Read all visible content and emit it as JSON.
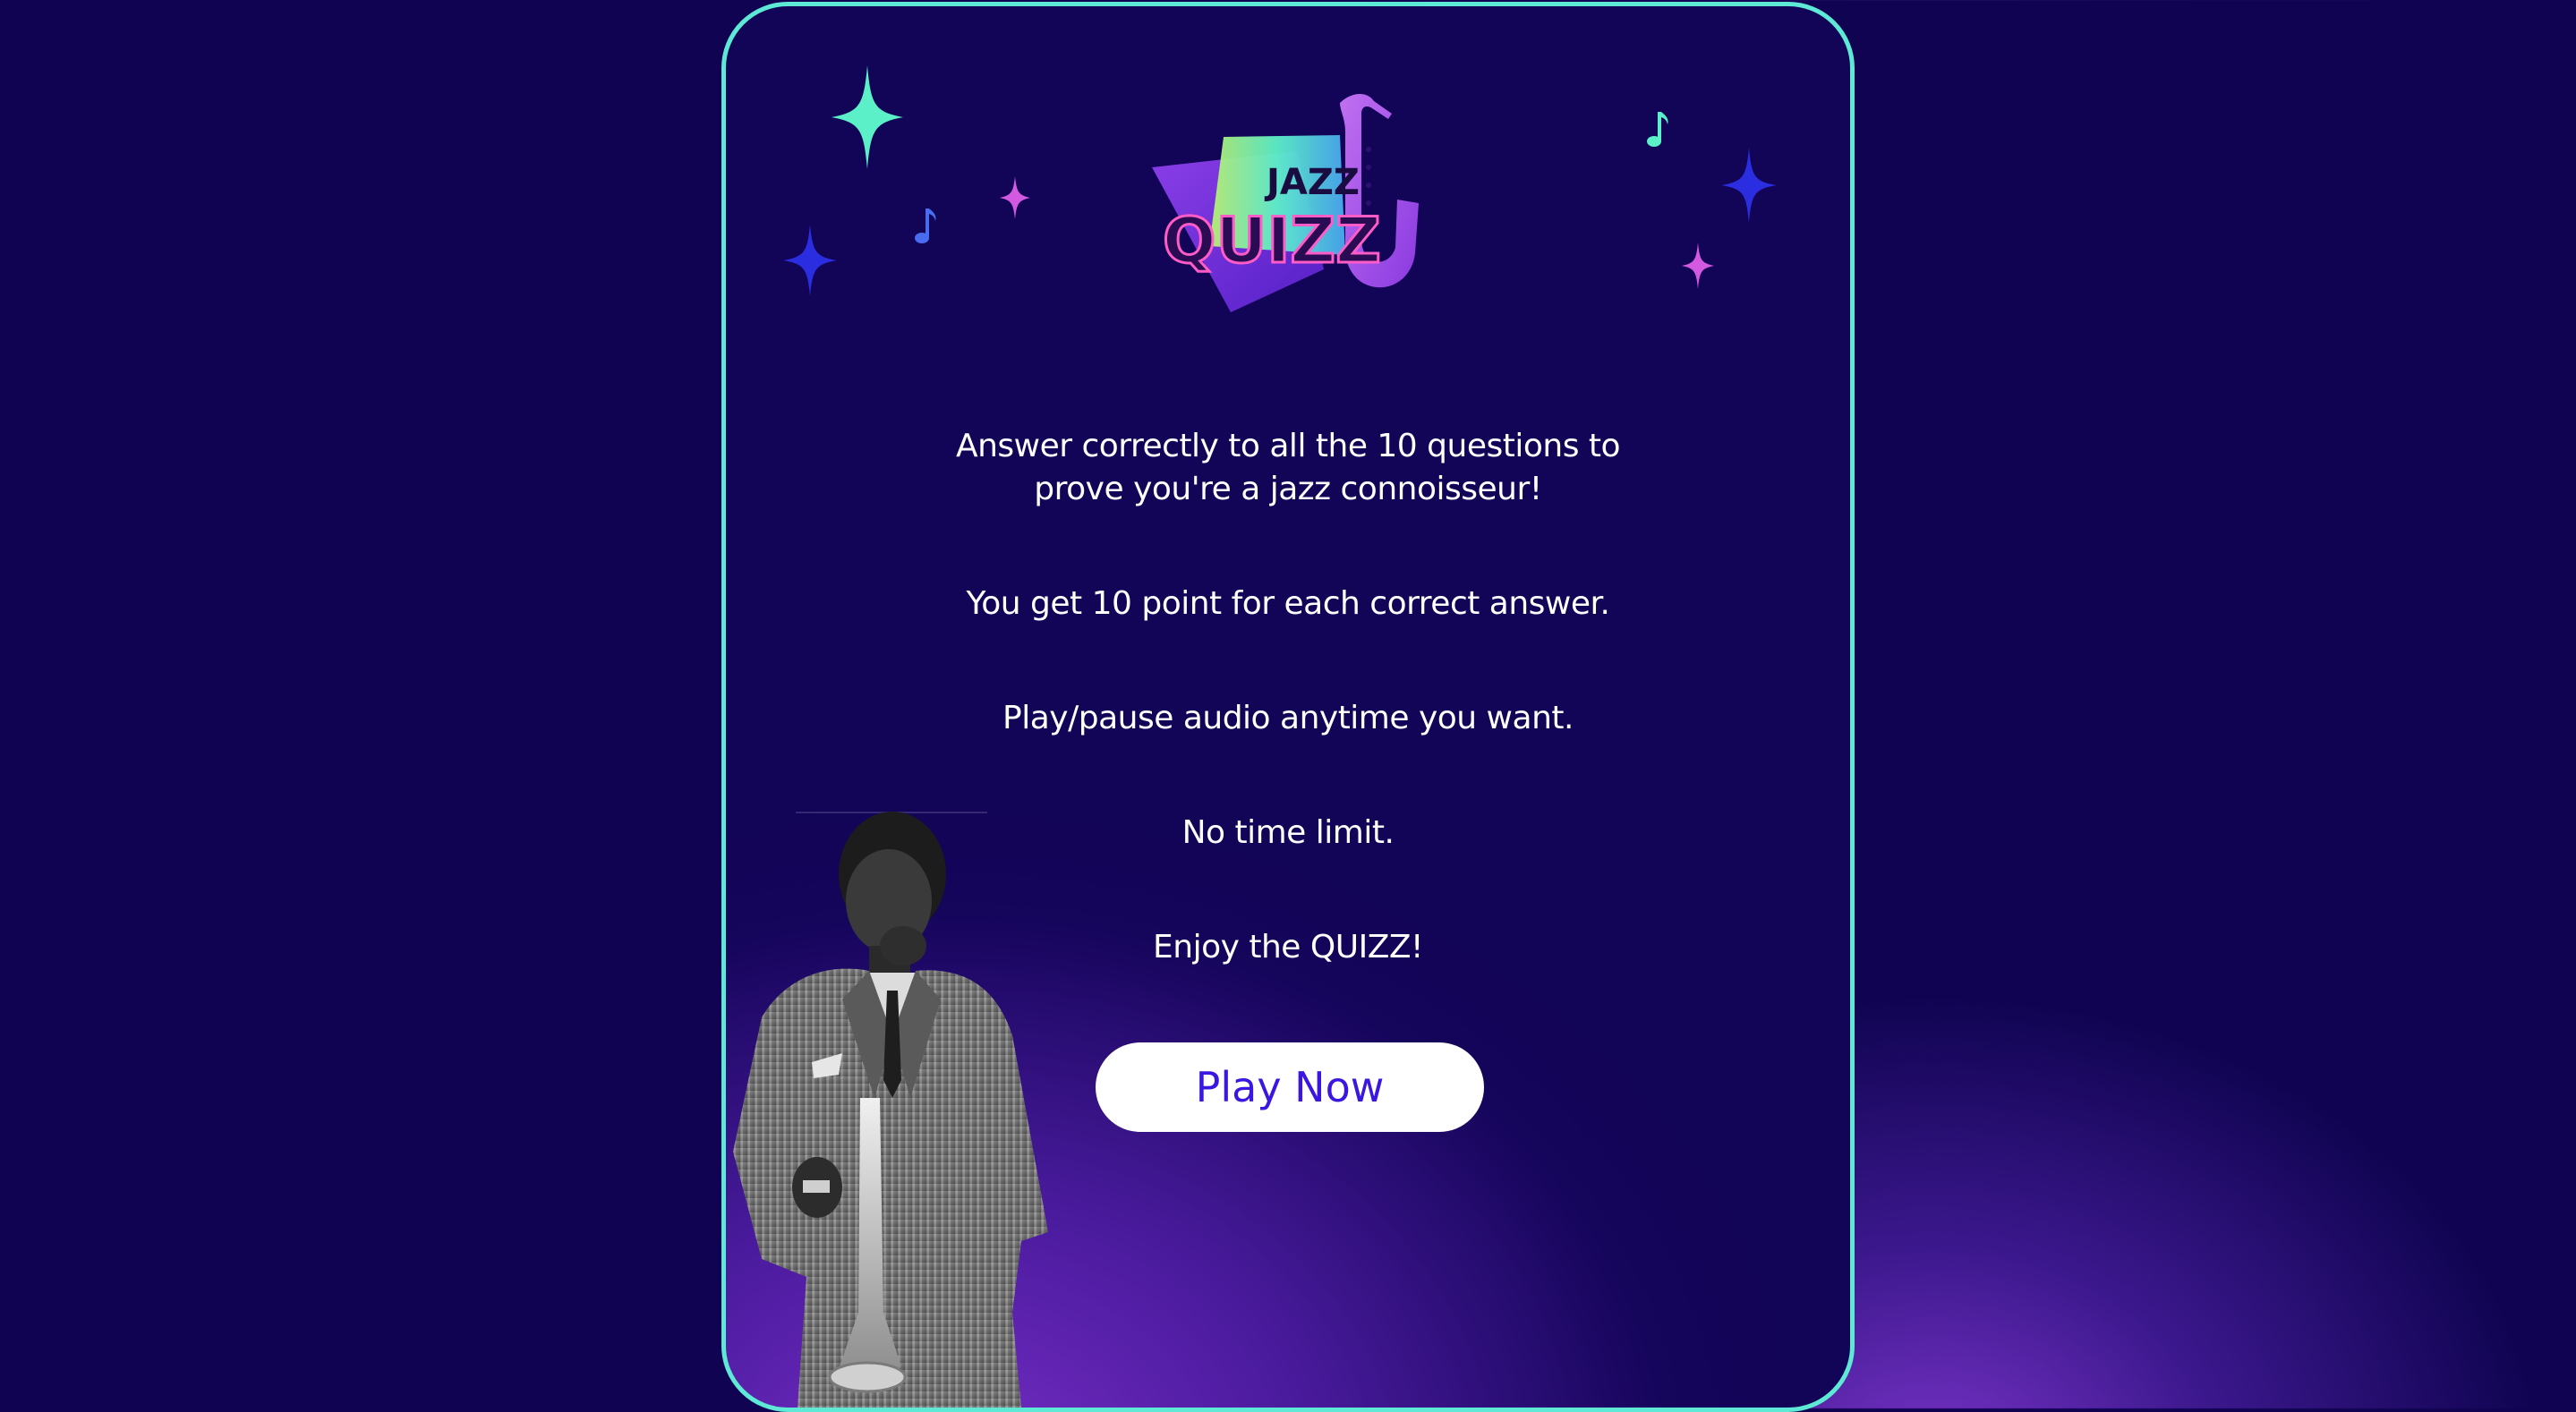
{
  "logo": {
    "line1": "JAZZ",
    "line2": "QUIZZ",
    "icon": "saxophone-icon"
  },
  "instructions": {
    "intro_line1": "Answer correctly to all the 10 questions to",
    "intro_line2": "prove you're a jazz connoisseur!",
    "points": "You get 10 point for each correct answer.",
    "audio": "Play/pause audio anytime you want.",
    "time": "No time limit.",
    "enjoy": "Enjoy the QUIZZ!"
  },
  "actions": {
    "play_label": "Play Now"
  },
  "colors": {
    "background": "#100452",
    "card_border": "#5ee8d6",
    "button_bg": "#ffffff",
    "button_text": "#3a16e0",
    "sparkle_mint": "#5cf0c8",
    "sparkle_blue": "#2a2ee0",
    "sparkle_pink": "#d35ae0"
  },
  "decorations": {
    "sparkles": [
      "sparkle-icon",
      "sparkle-icon",
      "sparkle-icon",
      "sparkle-icon",
      "sparkle-icon",
      "sparkle-icon"
    ],
    "notes": [
      "music-note-icon",
      "music-note-icon"
    ],
    "photo": "trumpet-player-photo"
  }
}
